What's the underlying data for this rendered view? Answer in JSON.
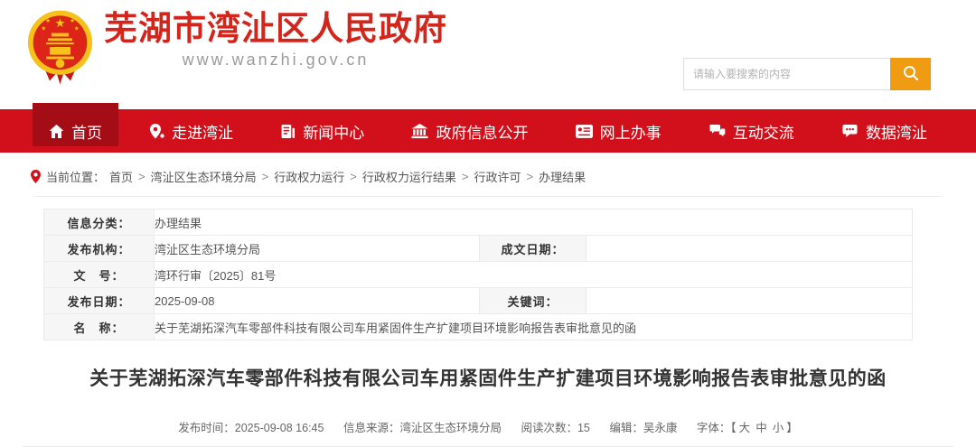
{
  "header": {
    "site_name": "芜湖市湾沚区人民政府",
    "site_url": "www.wanzhi.gov.cn",
    "search": {
      "placeholder": "请输入要搜索的内容"
    }
  },
  "nav": {
    "items": [
      {
        "label": "首页",
        "icon": "home-icon",
        "active": true
      },
      {
        "label": "走进湾沚",
        "icon": "location-icon",
        "active": false
      },
      {
        "label": "新闻中心",
        "icon": "news-icon",
        "active": false
      },
      {
        "label": "政府信息公开",
        "icon": "gov-building-icon",
        "active": false
      },
      {
        "label": "网上办事",
        "icon": "services-card-icon",
        "active": false
      },
      {
        "label": "互动交流",
        "icon": "chat-bubbles-icon",
        "active": false
      },
      {
        "label": "数据湾沚",
        "icon": "data-bubble-icon",
        "active": false
      }
    ]
  },
  "breadcrumb": {
    "prefix": "当前位置：",
    "separator": ">",
    "items": [
      "首页",
      "湾沚区生态环境分局",
      "行政权力运行",
      "行政权力运行结果",
      "行政许可",
      "办理结果"
    ]
  },
  "info_table": {
    "rows": [
      {
        "label": "信息分类：",
        "value": "办理结果"
      },
      {
        "label": "发布机构：",
        "value": "湾沚区生态环境分局",
        "label2": "成文日期：",
        "value2": ""
      },
      {
        "label": "文　号：",
        "value": "湾环行审〔2025〕81号"
      },
      {
        "label": "发布日期：",
        "value": "2025-09-08",
        "label2": "关键词：",
        "value2": ""
      },
      {
        "label": "名　称：",
        "value": "关于芜湖拓深汽车零部件科技有限公司车用紧固件生产扩建项目环境影响报告表审批意见的函"
      }
    ]
  },
  "article": {
    "title": "关于芜湖拓深汽车零部件科技有限公司车用紧固件生产扩建项目环境影响报告表审批意见的函",
    "meta": {
      "publish_time_label": "发布时间：",
      "publish_time": "2025-09-08 16:45",
      "source_label": "信息来源：",
      "source": "湾沚区生态环境分局",
      "views_label": "阅读次数：",
      "views": "15",
      "editor_label": "编辑：",
      "editor": "吴永康",
      "font_label": "字体：",
      "bracket_open": "【",
      "bracket_close": "】",
      "font_sizes": [
        "大",
        "中",
        "小"
      ]
    }
  },
  "colors": {
    "nav_red": "#d2101b",
    "nav_active_red": "#a40d15",
    "title_red": "#d4251d",
    "search_orange": "#f09c12"
  }
}
